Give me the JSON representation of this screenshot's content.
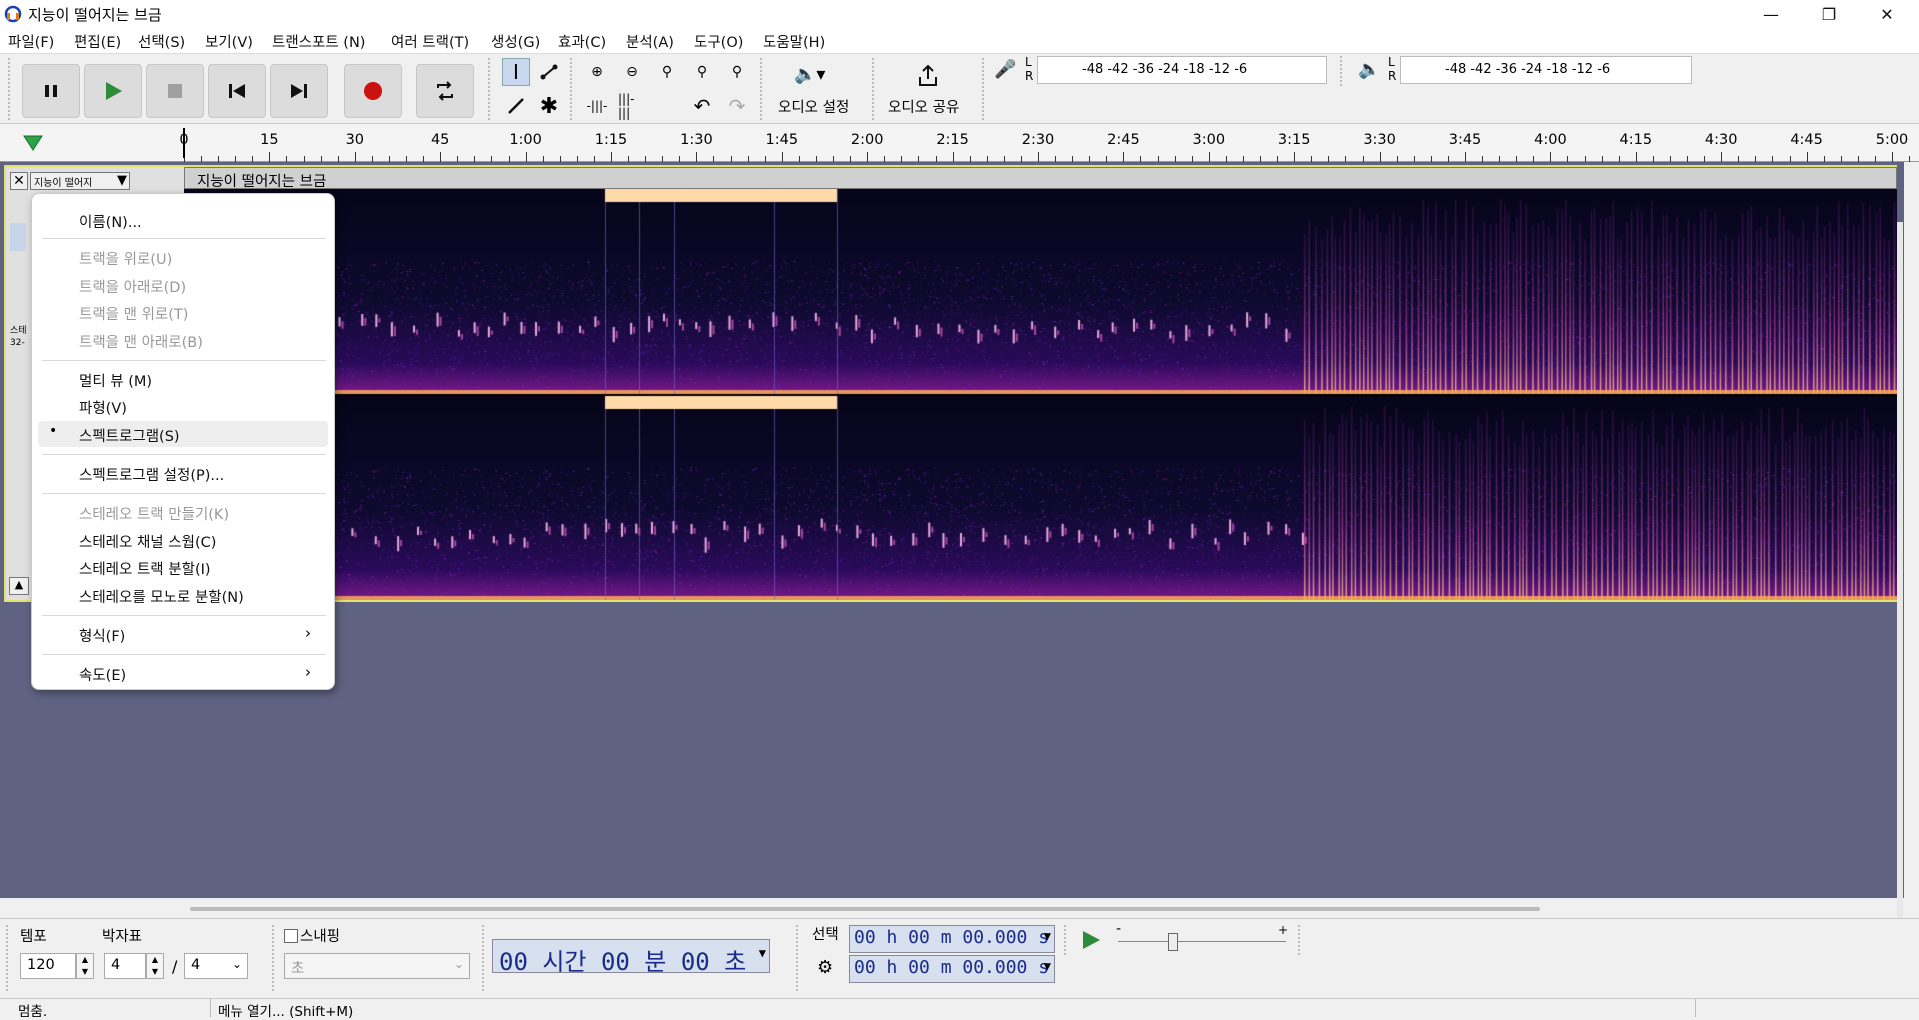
{
  "window": {
    "title": "지능이 떨어지는 브금"
  },
  "menu": [
    "파일(F)",
    "편집(E)",
    "선택(S)",
    "보기(V)",
    "트랜스포트 (N)",
    "여러 트랙(T)",
    "생성(G)",
    "효과(C)",
    "분석(A)",
    "도구(O)",
    "도움말(H)"
  ],
  "toolbar": {
    "audio_setup_label": "오디오 설정",
    "audio_share_label": "오디오 공유",
    "rec_meter_lr": [
      "L",
      "R"
    ],
    "play_meter_lr": [
      "L",
      "R"
    ],
    "meter_scale": "-48 -42 -36     -24 -18 -12  -6"
  },
  "ruler": [
    "0",
    "15",
    "30",
    "45",
    "1:00",
    "1:15",
    "1:30",
    "1:45",
    "2:00",
    "2:15",
    "2:30",
    "2:45",
    "3:00",
    "3:15",
    "3:30",
    "3:45",
    "4:00",
    "4:15",
    "4:30",
    "4:45",
    "5:00"
  ],
  "track": {
    "name": "지능이 떨어지",
    "clip_title": "지능이 떨어지는 브금",
    "partial_labels": [
      "스테",
      "32-"
    ]
  },
  "context_menu": {
    "name": "이름(N)...",
    "move_up": "트랙을 위로(U)",
    "move_down": "트랙을 아래로(D)",
    "move_top": "트랙을 맨 위로(T)",
    "move_bottom": "트랙을 맨 아래로(B)",
    "multi_view": "멀티 뷰 (M)",
    "waveform": "파형(V)",
    "spectrogram": "스펙트로그램(S)",
    "spectrogram_settings": "스펙트로그램 설정(P)...",
    "make_stereo": "스테레오 트랙 만들기(K)",
    "swap_channels": "스테레오 채널 스웝(C)",
    "split_stereo": "스테레오 트랙 분할(I)",
    "split_mono": "스테레오를 모노로 분할(N)",
    "format": "형식(F)",
    "rate": "속도(E)"
  },
  "bottom": {
    "tempo_label": "템포",
    "tempo_value": "120",
    "time_sig_label": "박자표",
    "time_sig_upper": "4",
    "time_sig_lower": "4",
    "time_sig_sep": "/",
    "snap_label": "스내핑",
    "snap_unit": "초",
    "time_display": "00 시간 00 분 00 초",
    "selection_label": "선택",
    "sel_start": "00 h 00 m 00.000 s",
    "sel_end": "00 h 00 m 00.000 s"
  },
  "status": {
    "left": "멈춤.",
    "right": "메뉴 열기... (Shift+M)"
  },
  "colors": {
    "track_bg": "#5f6280",
    "selected_border": "#e2e26a",
    "lcd_text": "#1a2b8a",
    "record": "#cc1111",
    "play": "#2e8b3a"
  }
}
